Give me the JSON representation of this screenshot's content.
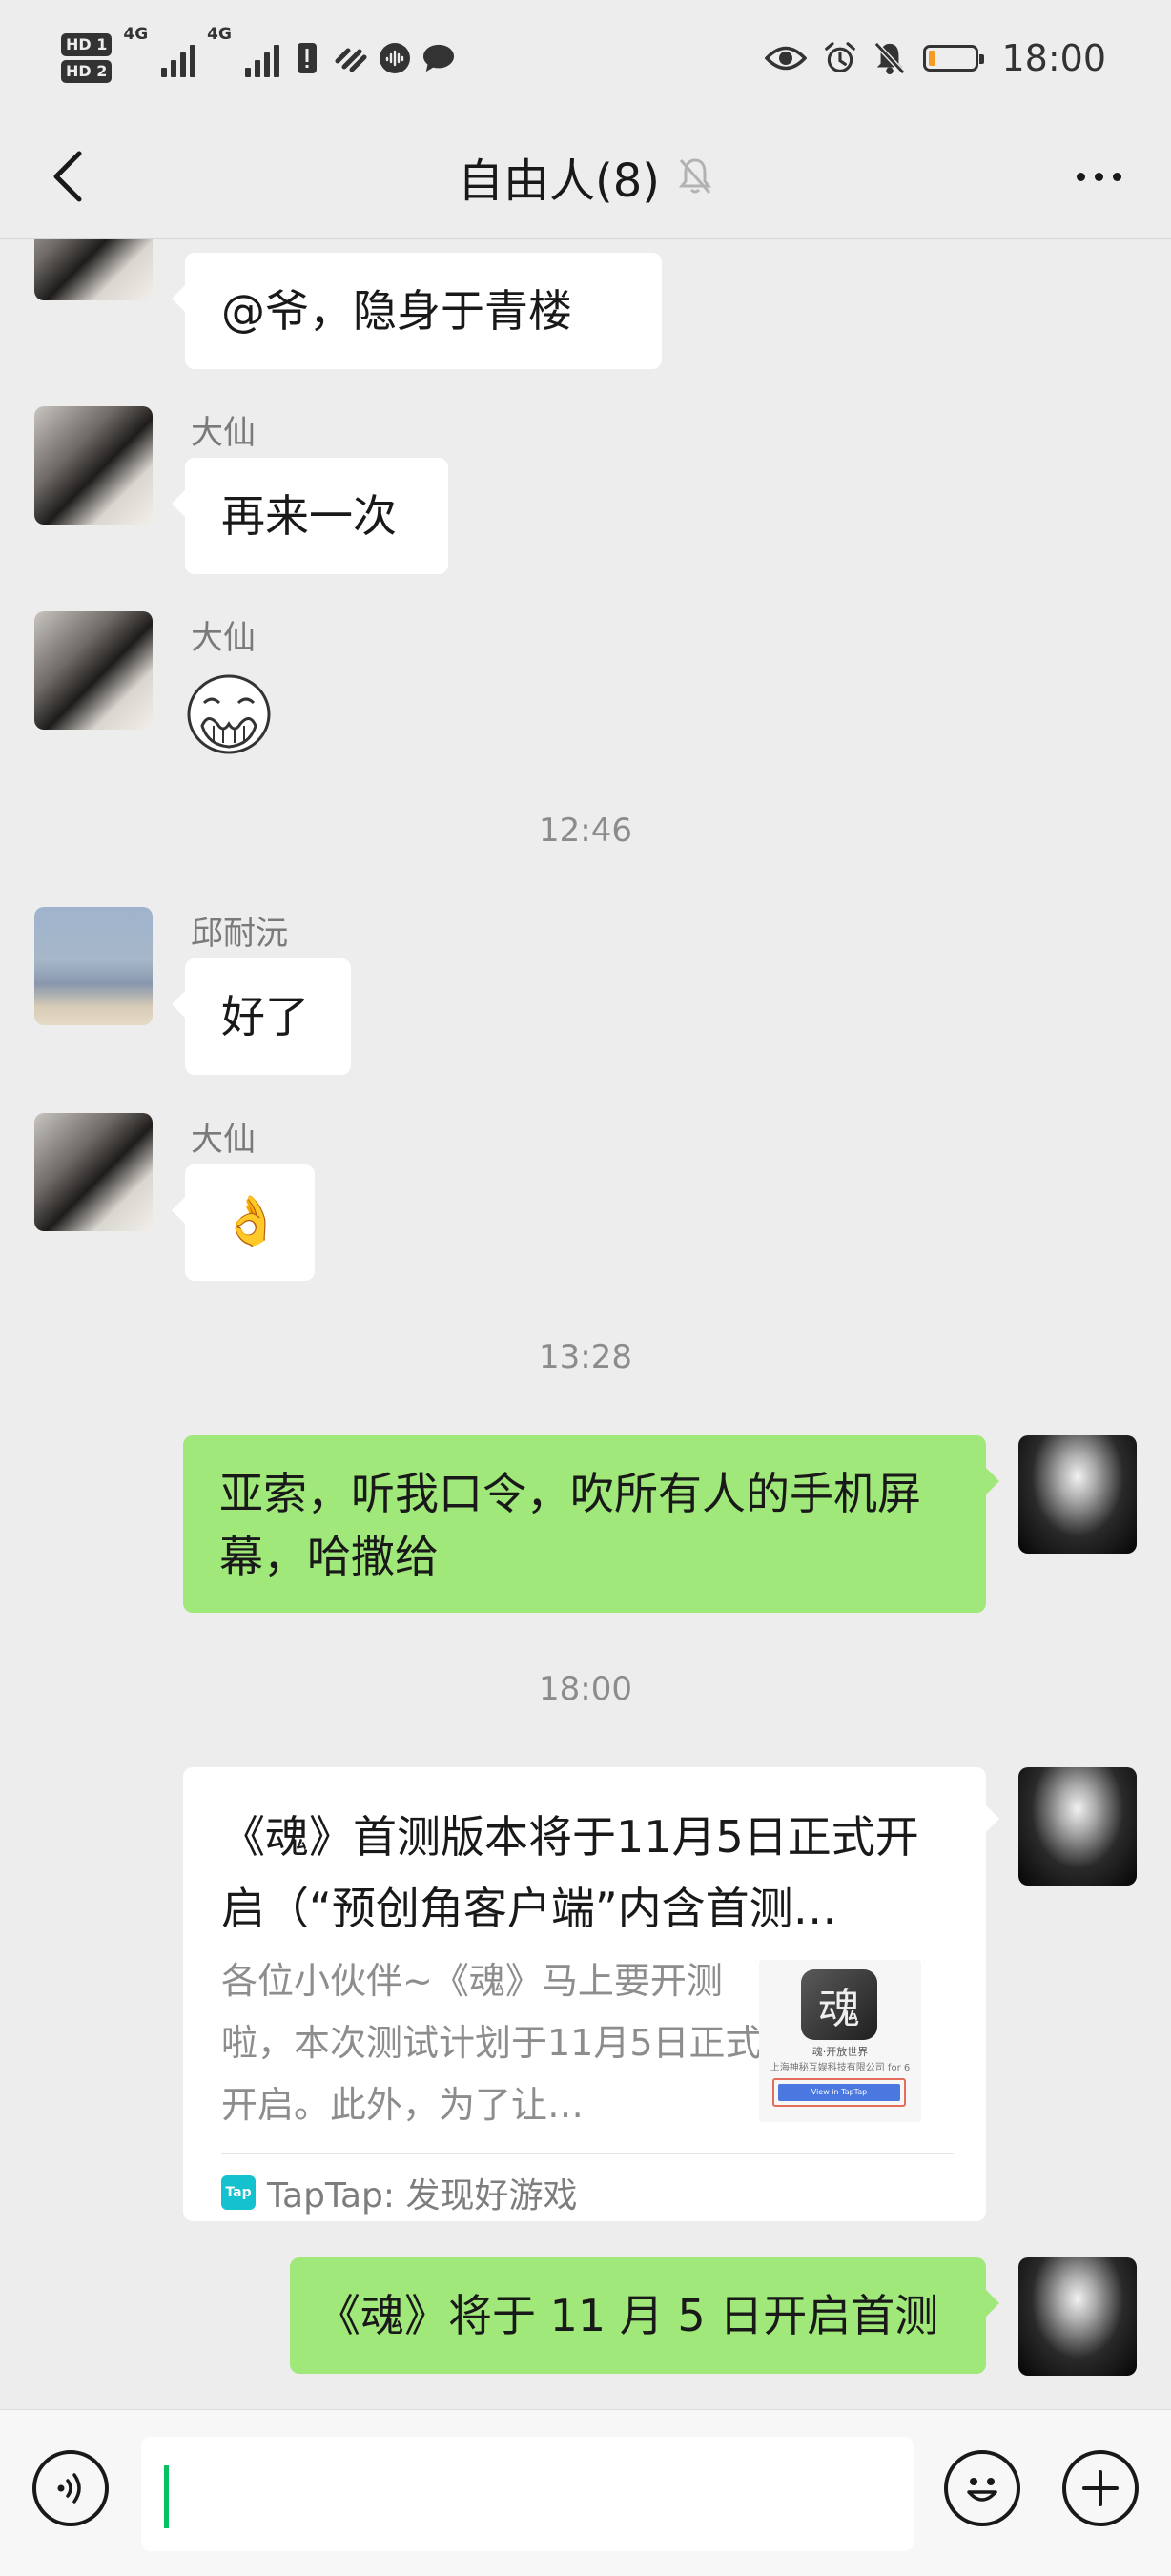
{
  "status_bar": {
    "hd1": "HD 1",
    "hd2": "HD 2",
    "net1": "4G",
    "net2": "4G",
    "time": "18:00",
    "battery_level": 0.15,
    "battery_color": "#f59a23"
  },
  "header": {
    "title": "自由人(8)",
    "back_icon": "chevron-left-icon",
    "mute_icon": "bell-off-icon",
    "more_icon": "more-dots-icon"
  },
  "messages": [
    {
      "sender": "大仙",
      "text": "@爷，隐身于青楼"
    },
    {
      "sender": "大仙",
      "text": "再来一次"
    },
    {
      "sender": "大仙",
      "sticker": "face-covering-mouth-sticker"
    },
    {
      "time": "12:46"
    },
    {
      "sender": "邱耐沅",
      "text": "好了"
    },
    {
      "sender": "大仙",
      "emoji": "👌"
    },
    {
      "time": "13:28"
    },
    {
      "self": true,
      "text": "亚索，听我口令，吹所有人的手机屏幕，哈撒给"
    },
    {
      "time": "18:00"
    },
    {
      "self": true,
      "card": {
        "title": "《魂》首测版本将于11月5日正式开启（“预创角客户端”内含首测…",
        "description": "各位小伙伴~《魂》马上要开测啦，本次测试计划于11月5日正式开启。此外，为了让…",
        "thumb_logo": "魂",
        "thumb_text1": "魂·开放世界",
        "thumb_text2": "上海神秘互娱科技有限公司 for 6",
        "thumb_button": "View in TapTap",
        "source_icon": "Tap",
        "source": "TapTap: 发现好游戏"
      }
    },
    {
      "self": true,
      "text": "《魂》将于 11 月 5 日开启首测"
    }
  ],
  "input_bar": {
    "voice_icon": "voice-icon",
    "emoji_icon": "smiley-icon",
    "plus_icon": "plus-icon",
    "value": ""
  }
}
